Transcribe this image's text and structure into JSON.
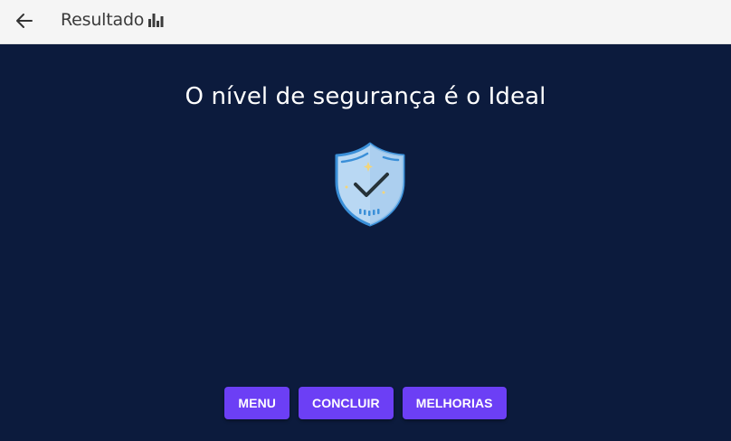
{
  "header": {
    "title": "Resultado",
    "back_icon": "arrow-left-icon",
    "title_icon": "bar-chart-icon"
  },
  "main": {
    "headline": "O nível de segurança é o Ideal",
    "result_icon": "shield-check-icon"
  },
  "buttons": {
    "menu": "MENU",
    "concluir": "CONCLUIR",
    "melhorias": "MELHORIAS"
  },
  "colors": {
    "background": "#0c1b3d",
    "topbar": "#f5f5f5",
    "button": "#6c3ff5",
    "shield_fill": "#b9d8f3",
    "shield_stroke": "#3a8fd8"
  }
}
